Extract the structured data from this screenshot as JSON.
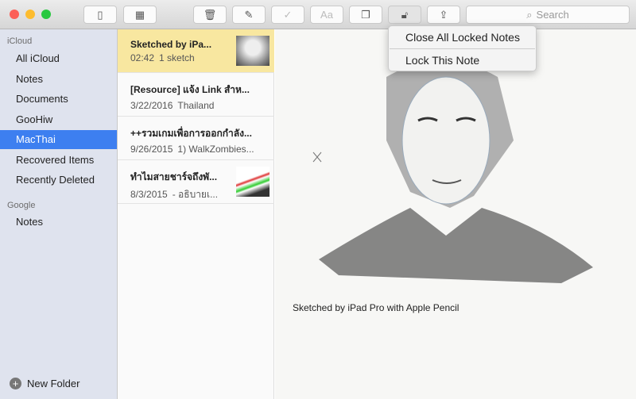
{
  "toolbar": {
    "search_placeholder": "Search",
    "icons": [
      "sidebar-toggle",
      "gallery-view",
      "trash",
      "compose",
      "checklist",
      "format",
      "table",
      "lock",
      "share"
    ]
  },
  "sidebar": {
    "sections": [
      {
        "title": "iCloud",
        "items": [
          "All iCloud",
          "Notes",
          "Documents",
          "GooHiw",
          "MacThai",
          "Recovered Items",
          "Recently Deleted"
        ]
      },
      {
        "title": "Google",
        "items": [
          "Notes"
        ]
      }
    ],
    "selected": "MacThai",
    "new_folder": "New Folder"
  },
  "notes": [
    {
      "title": "Sketched by iPa...",
      "date": "02:42",
      "preview": "1 sketch"
    },
    {
      "title": "[Resource] แจ้ง Link สำห...",
      "date": "3/22/2016",
      "preview": "Thailand"
    },
    {
      "title": "++รวมเกมเพื่อการออกกำลัง...",
      "date": "9/26/2015",
      "preview": "1) WalkZombies..."
    },
    {
      "title": "ทำไมสายชาร์จถึงพั...",
      "date": "8/3/2015",
      "preview": "- อธิบายเ..."
    }
  ],
  "editor": {
    "caption": "Sketched by iPad Pro with Apple Pencil"
  },
  "lock_menu": {
    "items": [
      "Close All Locked Notes",
      "Lock This Note"
    ]
  },
  "colors": {
    "accent": "#3d7ff0",
    "selected_note": "#f8e7a0",
    "sidebar": "#dfe3ee"
  }
}
